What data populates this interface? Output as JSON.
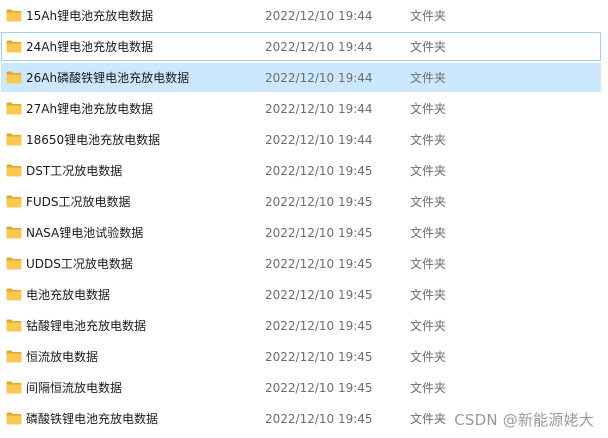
{
  "icon_colors": {
    "folder_back": "#e0a82e",
    "folder_front": "#f8c94c",
    "selection_bg": "#cce8ff",
    "selection_border": "#99d1ff"
  },
  "files": [
    {
      "name": "15Ah锂电池充放电数据",
      "date": "2022/12/10 19:44",
      "type": "文件夹",
      "icon": "folder-icon"
    },
    {
      "name": "24Ah锂电池充放电数据",
      "date": "2022/12/10 19:44",
      "type": "文件夹",
      "icon": "folder-icon"
    },
    {
      "name": "26Ah磷酸铁锂电池充放电数据",
      "date": "2022/12/10 19:44",
      "type": "文件夹",
      "icon": "folder-icon"
    },
    {
      "name": "27Ah锂电池充放电数据",
      "date": "2022/12/10 19:44",
      "type": "文件夹",
      "icon": "folder-icon"
    },
    {
      "name": "18650锂电池充放电数据",
      "date": "2022/12/10 19:44",
      "type": "文件夹",
      "icon": "folder-icon"
    },
    {
      "name": "DST工况放电数据",
      "date": "2022/12/10 19:45",
      "type": "文件夹",
      "icon": "folder-icon"
    },
    {
      "name": "FUDS工况放电数据",
      "date": "2022/12/10 19:45",
      "type": "文件夹",
      "icon": "folder-icon"
    },
    {
      "name": "NASA锂电池试验数据",
      "date": "2022/12/10 19:45",
      "type": "文件夹",
      "icon": "folder-icon"
    },
    {
      "name": "UDDS工况放电数据",
      "date": "2022/12/10 19:45",
      "type": "文件夹",
      "icon": "folder-icon"
    },
    {
      "name": "电池充放电数据",
      "date": "2022/12/10 19:45",
      "type": "文件夹",
      "icon": "folder-icon"
    },
    {
      "name": "钴酸锂电池充放电数据",
      "date": "2022/12/10 19:45",
      "type": "文件夹",
      "icon": "folder-icon"
    },
    {
      "name": "恒流放电数据",
      "date": "2022/12/10 19:45",
      "type": "文件夹",
      "icon": "folder-icon"
    },
    {
      "name": "间隔恒流放电数据",
      "date": "2022/12/10 19:45",
      "type": "文件夹",
      "icon": "folder-icon"
    },
    {
      "name": "磷酸铁锂电池充放电数据",
      "date": "2022/12/10 19:45",
      "type": "文件夹",
      "icon": "folder-icon"
    }
  ],
  "watermark": "CSDN @新能源姥大"
}
